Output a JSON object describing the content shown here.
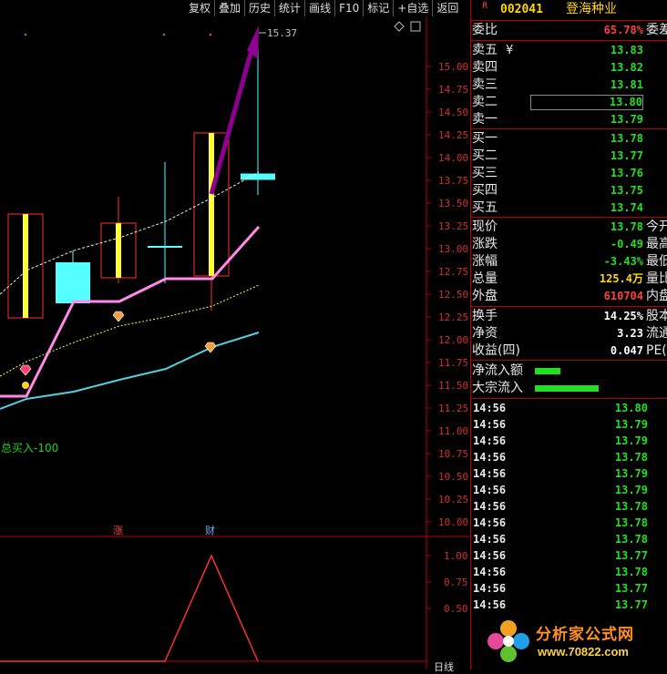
{
  "toolbar": [
    "复权",
    "叠加",
    "历史",
    "统计",
    "画线",
    "F10",
    "标记",
    "+自选",
    "返回"
  ],
  "chart_data": {
    "type": "candlestick",
    "ylim": [
      9.85,
      15.55
    ],
    "yticks": [
      "15.00",
      "14.75",
      "14.50",
      "14.25",
      "14.00",
      "13.75",
      "13.50",
      "13.25",
      "13.00",
      "12.75",
      "12.50",
      "12.25",
      "12.00",
      "11.75",
      "11.50",
      "11.25",
      "11.00",
      "10.75",
      "10.50",
      "10.25",
      "10.00"
    ],
    "high_label": "15.37",
    "candles": [
      {
        "open": 13.38,
        "close": 12.24,
        "high": 13.38,
        "low": 12.24,
        "color": "red"
      },
      {
        "open": 12.4,
        "close": 12.85,
        "high": 12.98,
        "low": 12.38,
        "color": "cyan"
      },
      {
        "open": 13.28,
        "close": 12.68,
        "high": 13.57,
        "low": 12.62,
        "color": "red"
      },
      {
        "open": 13.02,
        "close": 13.02,
        "high": 13.95,
        "low": 12.62,
        "color": "cyan"
      },
      {
        "open": 12.7,
        "close": 14.27,
        "high": 14.27,
        "low": 12.32,
        "color": "red"
      },
      {
        "open": 13.79,
        "close": 13.79,
        "high": 15.37,
        "low": 13.59,
        "color": "cyan"
      }
    ],
    "signal_text": "总买入-100",
    "bottom_labels": [
      "涨",
      "财"
    ],
    "sub_ticks": [
      "1.00",
      "0.75",
      "0.50"
    ],
    "sub_values": [
      0,
      0,
      0,
      0,
      1,
      0
    ]
  },
  "stock": {
    "market_badge": "R",
    "code": "002041",
    "name": "登海种业"
  },
  "weibi": {
    "label": "委比",
    "value": "65.78%",
    "ext": "委差"
  },
  "asks": [
    {
      "label": "卖五",
      "suffix": "¥",
      "price": "13.83"
    },
    {
      "label": "卖四",
      "price": "13.82"
    },
    {
      "label": "卖三",
      "price": "13.81"
    },
    {
      "label": "卖二",
      "price": "13.80"
    },
    {
      "label": "卖一",
      "price": "13.79"
    }
  ],
  "bids": [
    {
      "label": "买一",
      "price": "13.78"
    },
    {
      "label": "买二",
      "price": "13.77"
    },
    {
      "label": "买三",
      "price": "13.76"
    },
    {
      "label": "买四",
      "price": "13.75"
    },
    {
      "label": "买五",
      "price": "13.74"
    }
  ],
  "stats": [
    {
      "label": "现价",
      "value": "13.78",
      "cls": "green",
      "ext": "今开"
    },
    {
      "label": "涨跌",
      "value": "-0.49",
      "cls": "green",
      "ext": "最高"
    },
    {
      "label": "涨幅",
      "value": "-3.43%",
      "cls": "green",
      "ext": "最低"
    },
    {
      "label": "总量",
      "value": "125.4万",
      "cls": "yellow",
      "ext": "量比"
    },
    {
      "label": "外盘",
      "value": "610704",
      "cls": "red",
      "ext": "内盘"
    }
  ],
  "stats2": [
    {
      "label": "换手",
      "value": "14.25%",
      "cls": "white",
      "ext": "股本"
    },
    {
      "label": "净资",
      "value": "3.23",
      "cls": "white",
      "ext": "流通"
    },
    {
      "label": "收益(四)",
      "value": "0.047",
      "cls": "white",
      "ext": "PE(动)"
    }
  ],
  "flows": [
    {
      "label": "净流入额",
      "bar": 0.2
    },
    {
      "label": "大宗流入",
      "bar": 0.5
    }
  ],
  "ticks": [
    {
      "time": "14:56",
      "price": "13.80"
    },
    {
      "time": "14:56",
      "price": "13.79"
    },
    {
      "time": "14:56",
      "price": "13.79"
    },
    {
      "time": "14:56",
      "price": "13.78"
    },
    {
      "time": "14:56",
      "price": "13.79"
    },
    {
      "time": "14:56",
      "price": "13.79"
    },
    {
      "time": "14:56",
      "price": "13.78"
    },
    {
      "time": "14:56",
      "price": "13.78"
    },
    {
      "time": "14:56",
      "price": "13.78"
    },
    {
      "time": "14:56",
      "price": "13.77"
    },
    {
      "time": "14:56",
      "price": "13.78"
    },
    {
      "time": "14:56",
      "price": "13.77"
    },
    {
      "time": "14:56",
      "price": "13.77"
    }
  ],
  "watermark": {
    "title": "分析家公式网",
    "url": "www.70822.com"
  },
  "bottom_corner": "日线",
  "colors": {
    "up": "#ff3030",
    "down": "#54ffff",
    "grid": "#b80000",
    "accent": "#800080"
  }
}
